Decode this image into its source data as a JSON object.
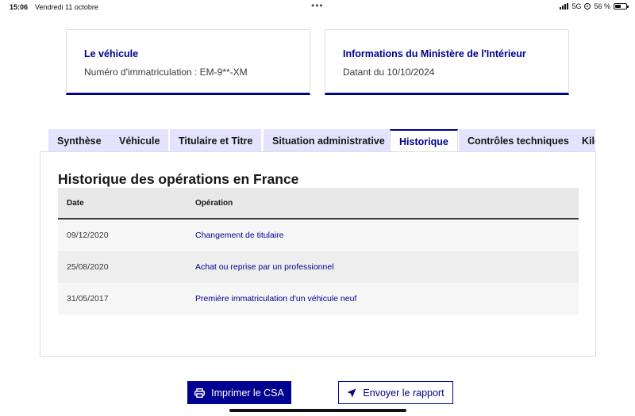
{
  "status_bar": {
    "time": "15:06",
    "date": "Vendredi 11 octobre",
    "network": "5G",
    "battery": "56 %",
    "battery_level": 0.56
  },
  "cards": [
    {
      "title": "Le véhicule",
      "text": "Numéro d'immatriculation : EM-9**-XM"
    },
    {
      "title": "Informations du Ministère de l'Intérieur",
      "text": "Datant du 10/10/2024"
    }
  ],
  "tabs": [
    {
      "label": "Synthèse",
      "active": false
    },
    {
      "label": "Véhicule",
      "active": false
    },
    {
      "label": "Titulaire et Titre",
      "active": false
    },
    {
      "label": "Situation administrative",
      "active": false
    },
    {
      "label": "Historique",
      "active": true
    },
    {
      "label": "Contrôles techniques",
      "active": false
    },
    {
      "label": "Kilométrage",
      "active": false
    }
  ],
  "history": {
    "title": "Historique des opérations en France",
    "columns": [
      "Date",
      "Opération"
    ],
    "rows": [
      {
        "date": "09/12/2020",
        "operation": "Changement de titulaire"
      },
      {
        "date": "25/08/2020",
        "operation": "Achat ou reprise par un professionnel"
      },
      {
        "date": "31/05/2017",
        "operation": "Première immatriculation d'un véhicule neuf"
      }
    ]
  },
  "actions": {
    "print_label": "Imprimer le CSA",
    "send_label": "Envoyer le rapport"
  },
  "colors": {
    "accent": "#000091",
    "tab_background": "#e3e3fd"
  },
  "icons": {
    "print": "printer-icon",
    "send": "send-icon"
  }
}
